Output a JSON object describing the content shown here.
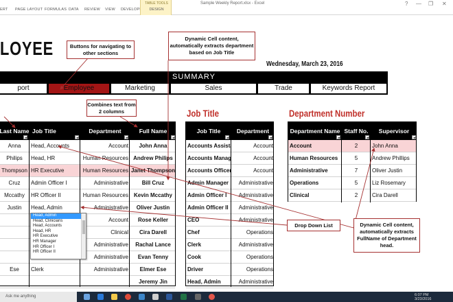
{
  "ribbon": {
    "tabs": [
      "ERT",
      "PAGE LAYOUT",
      "FORMULAS",
      "DATA",
      "REVIEW",
      "VIEW",
      "DEVELOPER"
    ],
    "table_tools": "TABLE TOOLS",
    "design_tab": "DESIGN",
    "window_title": "Sample Weekly Report.xlsx - Excel"
  },
  "heading": {
    "title": "LOYEE",
    "date": "Wednesday, March 23, 2016"
  },
  "summary": {
    "label": "SUMMARY",
    "nav": [
      "port",
      "Employee",
      "Marketing",
      "Sales",
      "Trade",
      "Keywords Report"
    ],
    "active": "Employee"
  },
  "callouts": {
    "nav_buttons": "Buttons for navigating to other sections",
    "dynamic_dept": "Dynamic Cell content, automatically extracts department based on Job Title",
    "combines": "Combines text from 2 columns",
    "dropdown": "Drop Down List",
    "dynamic_head": "Dynamic Cell content, automatically extracts FullName of Department head."
  },
  "employee_table": {
    "headers": [
      "Last Name",
      "Job Title",
      "Department",
      "Full Name"
    ],
    "rows": [
      [
        "Anna",
        "Head, Accounts",
        "Account",
        "John Anna"
      ],
      [
        "Philips",
        "Head, HR",
        "Human Resources",
        "Andrew Philips"
      ],
      [
        "Thompson",
        "HR Executive",
        "Human Resources",
        "Janet Thompson"
      ],
      [
        "Cruz",
        "Admin Officer I",
        "Administrative",
        "Bill Cruz"
      ],
      [
        "Mccathy",
        "HR Officer II",
        "Human Resources",
        "Kevin Mccathy"
      ],
      [
        "Justin",
        "Head, Admin",
        "Administrative",
        "Oliver Justin"
      ],
      [
        "",
        "",
        "Account",
        "Rose Keller"
      ],
      [
        "",
        "",
        "Clinical",
        "Cira Darell"
      ],
      [
        "",
        "",
        "Administrative",
        "Rachal Lance"
      ],
      [
        "",
        "",
        "Administrative",
        "Evan Tenny"
      ],
      [
        "Ese",
        "Clerk",
        "Administrative",
        "Elmer Ese"
      ],
      [
        "",
        "",
        "",
        "Jeremy Jin"
      ]
    ],
    "highlight_row": 2
  },
  "dropdown": {
    "items": [
      "Head, Admin",
      "Head, Clinicians",
      "Head, Accounts",
      "Head, HR",
      "HR Executive",
      "HR Manager",
      "HR Officer I",
      "HR Officer II"
    ],
    "selected": 0
  },
  "job_title": {
    "title": "Job Title",
    "headers": [
      "Job Title",
      "Department"
    ],
    "rows": [
      [
        "Accounts Assistant",
        "Account"
      ],
      [
        "Accounts Manager",
        "Account"
      ],
      [
        "Accounts Officer",
        "Account"
      ],
      [
        "Admin Manager",
        "Administrative"
      ],
      [
        "Admin Officer I",
        "Administrative"
      ],
      [
        "Admin Officer II",
        "Administrative"
      ],
      [
        "CEO",
        "Administrative"
      ],
      [
        "Chef",
        "Operations"
      ],
      [
        "Clerk",
        "Administrative"
      ],
      [
        "Cook",
        "Operations"
      ],
      [
        "Driver",
        "Operations"
      ],
      [
        "Head, Admin",
        "Administrative"
      ]
    ]
  },
  "department": {
    "title": "Department Number",
    "headers": [
      "Department Name",
      "Staff No.",
      "Supervisor"
    ],
    "rows": [
      [
        "Account",
        "2",
        "John Anna"
      ],
      [
        "Human Resources",
        "5",
        "Andrew Phillips"
      ],
      [
        "Administrative",
        "7",
        "Oliver Justin"
      ],
      [
        "Operations",
        "5",
        "Liz Rosemary"
      ],
      [
        "Clinical",
        "2",
        "Cira Darell"
      ]
    ],
    "highlight_row": 0
  },
  "taskbar": {
    "search": "Ask me anything",
    "time": "6:07 PM",
    "date": "3/23/2016"
  },
  "colors": {
    "accent_red": "#c0302a",
    "nav_active": "#a31515",
    "highlight": "#f9d4d6"
  }
}
